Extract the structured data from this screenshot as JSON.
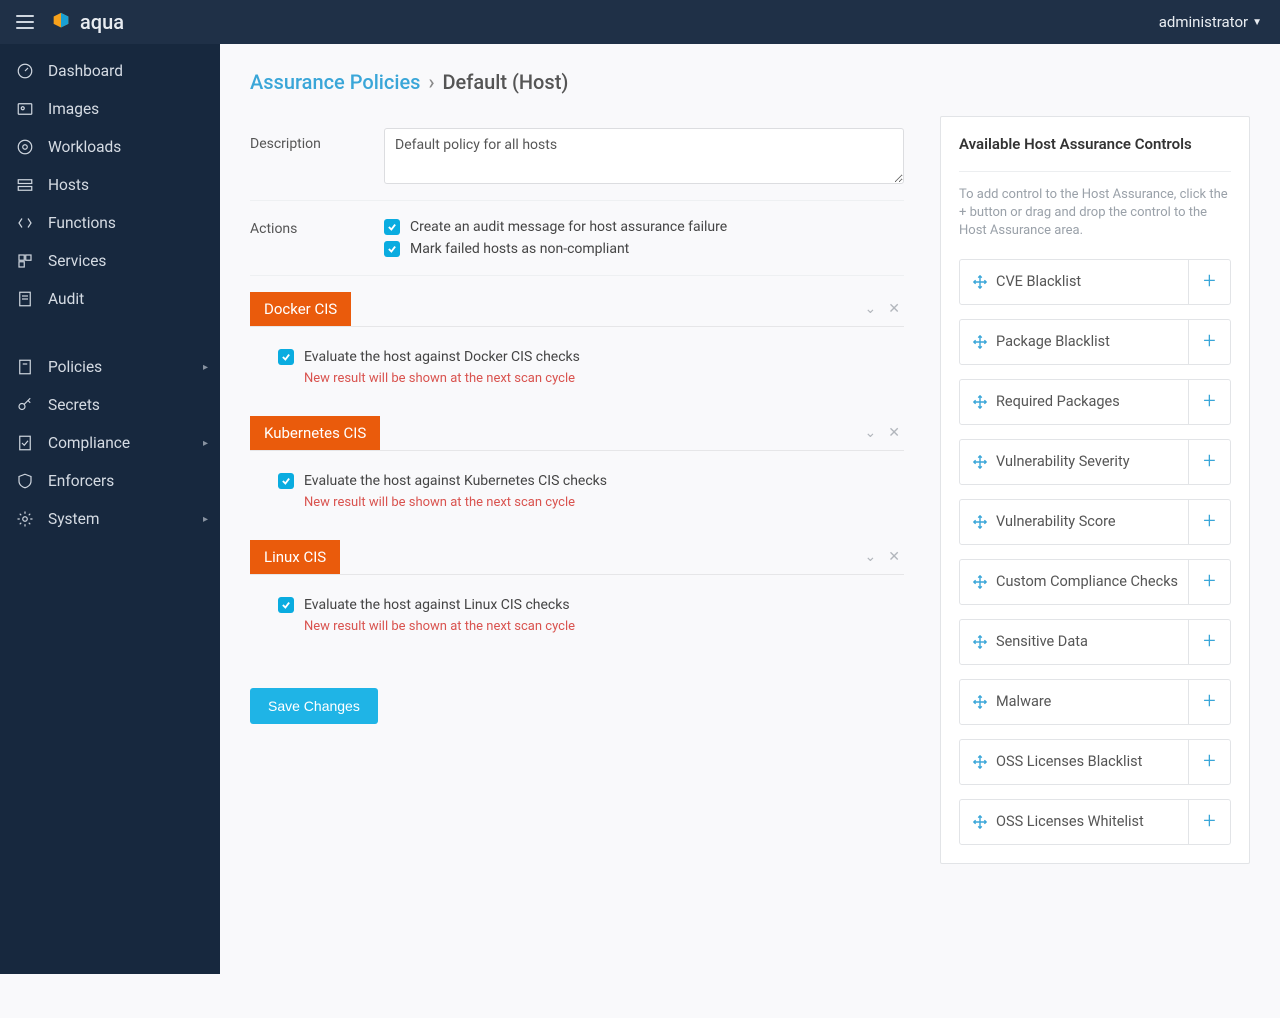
{
  "app": {
    "name": "aqua",
    "user": "administrator"
  },
  "sidebar": {
    "group1": [
      {
        "label": "Dashboard"
      },
      {
        "label": "Images"
      },
      {
        "label": "Workloads"
      },
      {
        "label": "Hosts"
      },
      {
        "label": "Functions"
      },
      {
        "label": "Services"
      },
      {
        "label": "Audit"
      }
    ],
    "group2": [
      {
        "label": "Policies",
        "expandable": true
      },
      {
        "label": "Secrets"
      },
      {
        "label": "Compliance",
        "expandable": true
      },
      {
        "label": "Enforcers"
      },
      {
        "label": "System",
        "expandable": true
      }
    ]
  },
  "breadcrumb": {
    "parent": "Assurance Policies",
    "current": "Default (Host)"
  },
  "form": {
    "labels": {
      "description": "Description",
      "actions": "Actions"
    },
    "description_value": "Default policy for all hosts",
    "actions": [
      "Create an audit message for host assurance failure",
      "Mark failed hosts as non-compliant"
    ]
  },
  "scan_note": "New result will be shown at the next scan cycle",
  "cis": [
    {
      "title": "Docker CIS",
      "check": "Evaluate the host against Docker CIS checks"
    },
    {
      "title": "Kubernetes CIS",
      "check": "Evaluate the host against Kubernetes CIS checks"
    },
    {
      "title": "Linux CIS",
      "check": "Evaluate the host against Linux CIS checks"
    }
  ],
  "save": "Save Changes",
  "right": {
    "title": "Available Host Assurance Controls",
    "help": "To add control to the Host Assurance, click the + button or drag and drop the control to the Host Assurance area.",
    "controls": [
      "CVE Blacklist",
      "Package Blacklist",
      "Required Packages",
      "Vulnerability Severity",
      "Vulnerability Score",
      "Custom Compliance Checks",
      "Sensitive Data",
      "Malware",
      "OSS Licenses Blacklist",
      "OSS Licenses Whitelist"
    ]
  }
}
